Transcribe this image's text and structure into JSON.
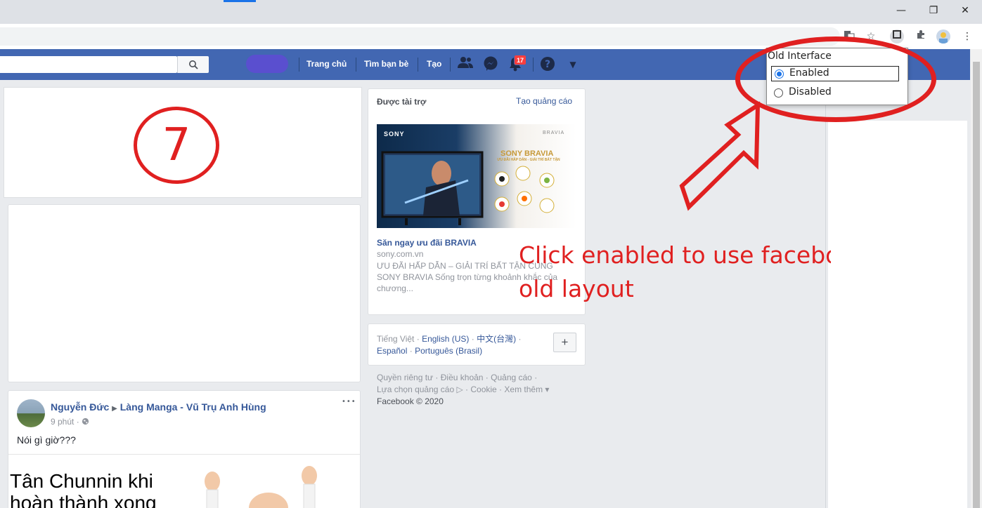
{
  "browser": {
    "window_controls": {
      "minimize": "—",
      "restore": "❐",
      "close": "✕"
    },
    "toolbar_icons": [
      "translate-icon",
      "star-icon",
      "extension-icon",
      "puzzle-icon",
      "avatar",
      "menu-icon"
    ]
  },
  "fb_nav": {
    "search_icon": "🔍",
    "links": [
      "Trang chủ",
      "Tìm bạn bè",
      "Tạo"
    ],
    "notification_count": "17",
    "icons": {
      "friends": "👥",
      "messenger": "💬",
      "notifications": "🔔",
      "help": "?",
      "dropdown": "▼"
    }
  },
  "annotations": {
    "circle_number": "7",
    "instruction_line1": "Click enabled to use facebo",
    "instruction_line2": "old layout",
    "color": "#e02020"
  },
  "popup": {
    "title": "Old Interface",
    "options": [
      {
        "label": "Enabled",
        "selected": true
      },
      {
        "label": "Disabled",
        "selected": false
      }
    ]
  },
  "ads": {
    "header": "Được tài trợ",
    "create_ad": "Tạo quảng cáo",
    "image": {
      "brand_left": "SONY",
      "brand_right": "BRAVIA",
      "headline": "SONY BRAVIA",
      "subline": "ƯU ĐÃI HẤP DẪN - GIẢI TRÍ BẤT TẬN"
    },
    "title": "Săn ngay ưu đãi BRAVIA",
    "domain": "sony.com.vn",
    "description": "ƯU ĐÃI HẤP DẪN – GIẢI TRÍ BẤT TẬN CÙNG SONY BRAVIA Sống trọn từng khoảnh khắc của chương..."
  },
  "languages": {
    "current": "Tiếng Việt",
    "sep": "·",
    "items": [
      "English (US)",
      "中文(台灣)",
      "Español",
      "Português (Brasil)"
    ],
    "add_button": "+"
  },
  "footer": {
    "line1": [
      "Quyền riêng tư",
      "Điều khoản",
      "Quảng cáo"
    ],
    "line2": [
      "Lựa chọn quảng cáo ▷",
      "Cookie",
      "Xem thêm ▾"
    ],
    "copyright": "Facebook © 2020"
  },
  "post": {
    "author": "Nguyễn Đức",
    "arrow": "▶",
    "group": "Làng Manga - Vũ Trụ Anh Hùng",
    "time": "9 phút",
    "privacy_icon": "🌐",
    "more": "•••",
    "text": "Nói gì giờ???",
    "image_caption_line1": "Tân Chunnin khi",
    "image_caption_line2": "hoàn thành xong"
  }
}
